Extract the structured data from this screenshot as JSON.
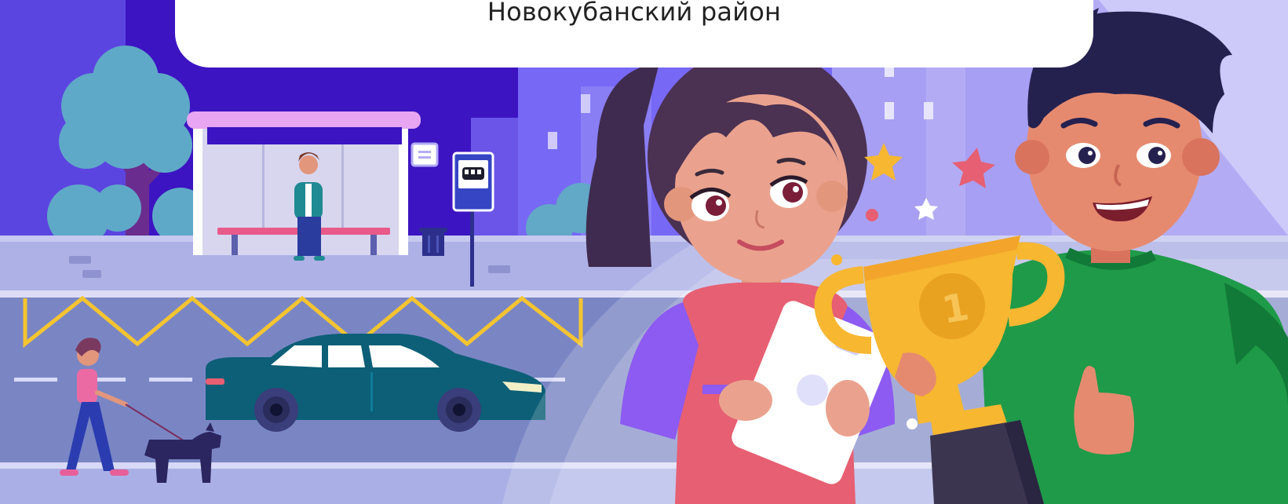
{
  "header": {
    "title": "Новокубанский район"
  },
  "colors": {
    "sky_left": "#5b45e0",
    "sky_dark": "#3c14c2",
    "sky_right": "#b3acf5",
    "sidewalk": "#aeb1e6",
    "road": "#7a86c4",
    "markings": "#f4c431",
    "car": "#0c5f77",
    "girl_dress": "#e75f72",
    "boy_shirt": "#1f9a48",
    "trophy": "#f7b731"
  },
  "icons": [
    "tree-icon",
    "bus-shelter",
    "bus-stop-sign-icon",
    "trash-bin-icon",
    "car-icon",
    "dog-icon",
    "trophy-icon",
    "star-icon"
  ]
}
